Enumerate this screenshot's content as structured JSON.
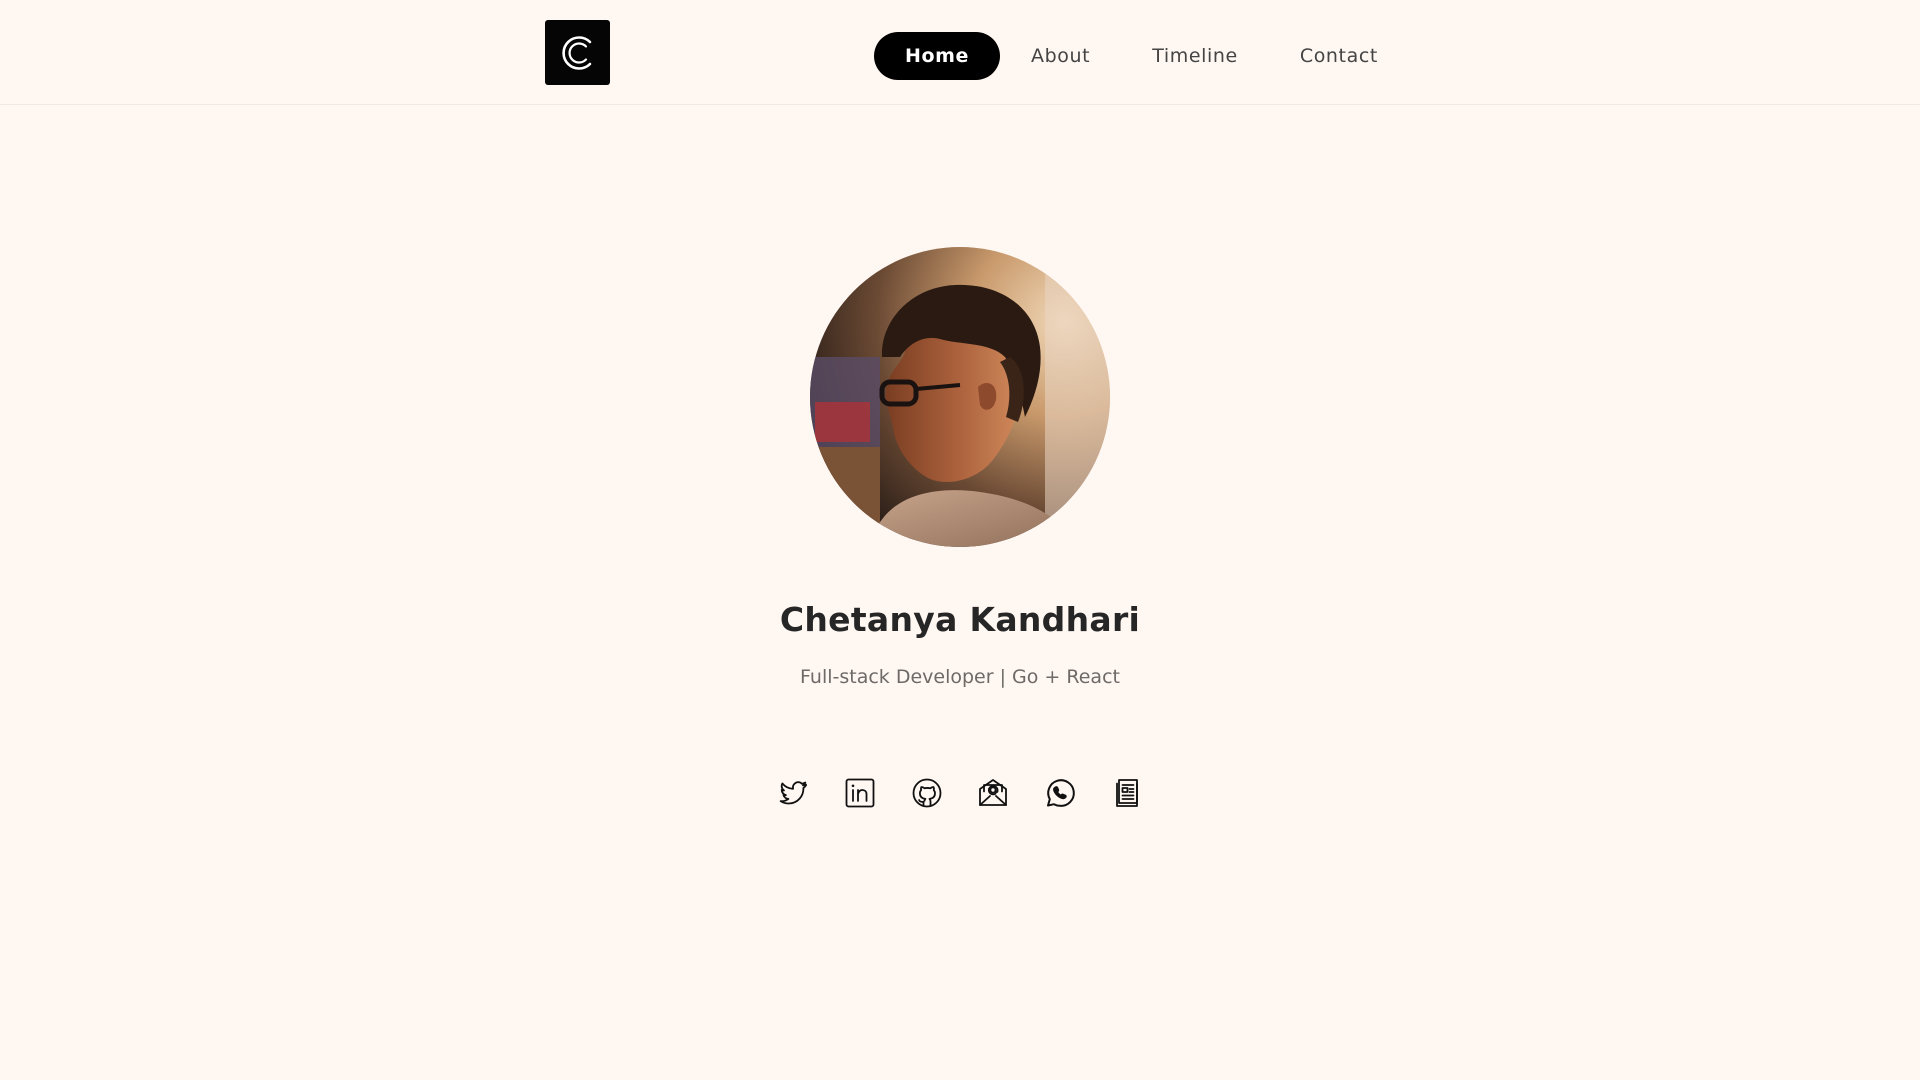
{
  "brand": {
    "logo_icon": "c-logo-icon",
    "logo_bg": "#050505",
    "logo_fg": "#ffffff"
  },
  "nav": {
    "items": [
      {
        "label": "Home",
        "active": true
      },
      {
        "label": "About",
        "active": false
      },
      {
        "label": "Timeline",
        "active": false
      },
      {
        "label": "Contact",
        "active": false
      }
    ]
  },
  "profile": {
    "name": "Chetanya Kandhari",
    "tagline": "Full-stack Developer | Go + React",
    "avatar_icon": "profile-photo"
  },
  "socials": [
    {
      "icon": "twitter-icon"
    },
    {
      "icon": "linkedin-icon"
    },
    {
      "icon": "github-icon"
    },
    {
      "icon": "email-icon"
    },
    {
      "icon": "whatsapp-icon"
    },
    {
      "icon": "resume-icon"
    }
  ],
  "colors": {
    "background": "#fff7f2",
    "accent": "#000000",
    "text": "#262626",
    "muted": "#6d6a68"
  }
}
